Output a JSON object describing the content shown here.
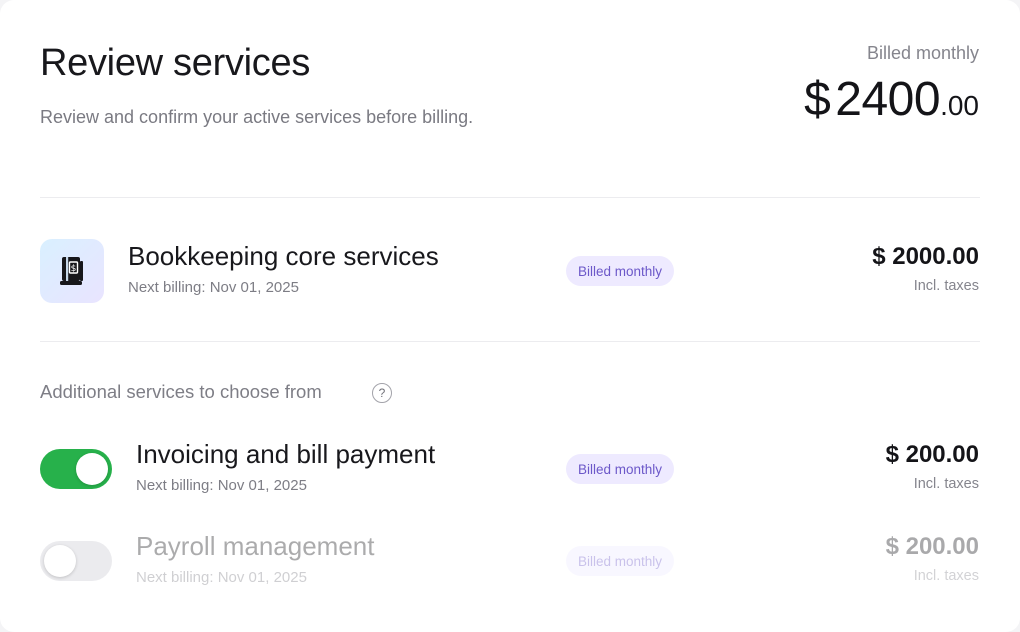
{
  "header": {
    "title": "Review services",
    "subtitle": "Review and confirm your active services before billing.",
    "billing_caption": "Billed monthly",
    "total": {
      "currency": "$",
      "amount": "2400",
      "cents": ".00"
    }
  },
  "core_service": {
    "icon": "ledger-dollar-icon",
    "name": "Bookkeeping core services",
    "next_billing": "Next billing: Nov 01, 2025",
    "badge": "Billed monthly",
    "price": "$ 2000.00",
    "price_note": "Incl. taxes"
  },
  "additional": {
    "label": "Additional services to choose from",
    "help_glyph": "?",
    "services": [
      {
        "name": "Invoicing and bill payment",
        "next_billing": "Next billing: Nov 01, 2025",
        "badge": "Billed monthly",
        "price": "$ 200.00",
        "price_note": "Incl. taxes",
        "enabled": true
      },
      {
        "name": "Payroll management",
        "next_billing": "Next billing: Nov 01, 2025",
        "badge": "Billed monthly",
        "price": "$ 200.00",
        "price_note": "Incl. taxes",
        "enabled": false
      }
    ]
  },
  "colors": {
    "toggle_on": "#27b14b",
    "badge_bg": "#eeeaff",
    "badge_text": "#6c58c9"
  }
}
